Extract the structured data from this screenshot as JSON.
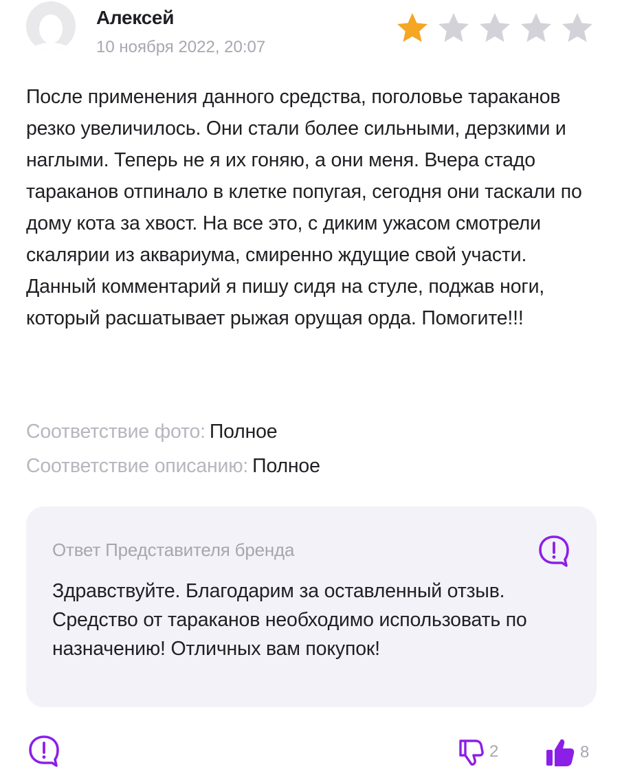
{
  "review": {
    "author": "Алексей",
    "date": "10 ноября 2022, 20:07",
    "rating": 1,
    "max_rating": 5,
    "text": "После применения данного средства, поголовье тараканов резко увеличилось. Они стали более сильными, дерзкими и наглыми. Теперь не я их гоняю, а они меня. Вчера стадо тараканов отпинало в клетке попугая, сегодня они таскали по дому кота за хвост. На все это, с диким ужасом смотрели скалярии из аквариума, смиренно ждущие свой участи. Данный комментарий я пишу сидя на стуле, поджав ноги, который расшатывает рыжая орущая орда. Помогите!!!",
    "attributes": [
      {
        "label": "Соответствие фото:",
        "value": "Полное"
      },
      {
        "label": "Соответствие описанию:",
        "value": "Полное"
      }
    ]
  },
  "brand_reply": {
    "title": "Ответ Представителя бренда",
    "text": "Здравствуйте. Благодарим за оставленный отзыв. Средство от тараканов необходимо использовать по назначению! Отличных вам покупок!",
    "icon": "report-icon"
  },
  "actions": {
    "report_icon": "report-icon",
    "dislike_icon": "thumbs-down-icon",
    "dislike_count": "2",
    "like_icon": "thumbs-up-icon",
    "like_count": "8"
  },
  "colors": {
    "star_filled": "#f5a623",
    "star_empty": "#d2d2d8",
    "accent": "#8b1fe8",
    "reply_bg": "#f3f2f8",
    "muted_text": "#a7a7b0"
  }
}
